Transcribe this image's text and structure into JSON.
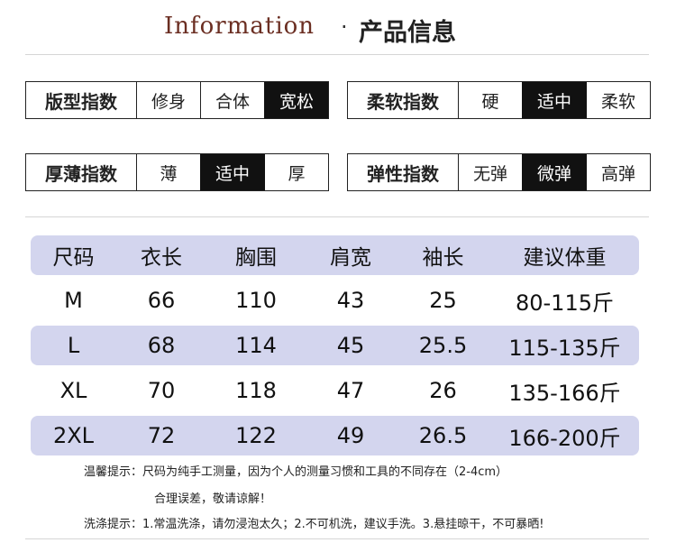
{
  "header": {
    "title_en": "Information",
    "dot": "·",
    "title_cn": "产品信息"
  },
  "indices": [
    {
      "label": "版型指数",
      "options": [
        "修身",
        "合体",
        "宽松"
      ],
      "selected": 2
    },
    {
      "label": "柔软指数",
      "options": [
        "硬",
        "适中",
        "柔软"
      ],
      "selected": 1
    },
    {
      "label": "厚薄指数",
      "options": [
        "薄",
        "适中",
        "厚"
      ],
      "selected": 1
    },
    {
      "label": "弹性指数",
      "options": [
        "无弹",
        "微弹",
        "高弹"
      ],
      "selected": 1
    }
  ],
  "size_table": {
    "columns": [
      "尺码",
      "衣长",
      "胸围",
      "肩宽",
      "袖长",
      "建议体重"
    ],
    "rows": [
      [
        "M",
        "66",
        "110",
        "43",
        "25",
        "80-115斤"
      ],
      [
        "L",
        "68",
        "114",
        "45",
        "25.5",
        "115-135斤"
      ],
      [
        "XL",
        "70",
        "118",
        "47",
        "26",
        "135-166斤"
      ],
      [
        "2XL",
        "72",
        "122",
        "49",
        "26.5",
        "166-200斤"
      ]
    ],
    "shade_color": "#d3d5ee"
  },
  "notes": {
    "tip_line1": "温馨提示：尺码为纯手工测量，因为个人的测量习惯和工具的不同存在（2-4cm）",
    "tip_line2": "合理误差，敬请谅解！",
    "wash": "洗涤提示：1.常温洗涤，请勿浸泡太久；2.不可机洗，建议手洗。3.悬挂晾干，不可暴晒!"
  },
  "colors": {
    "title_en": "#6b2e22",
    "selected_bg": "#111111",
    "selected_text": "#ffffff"
  }
}
